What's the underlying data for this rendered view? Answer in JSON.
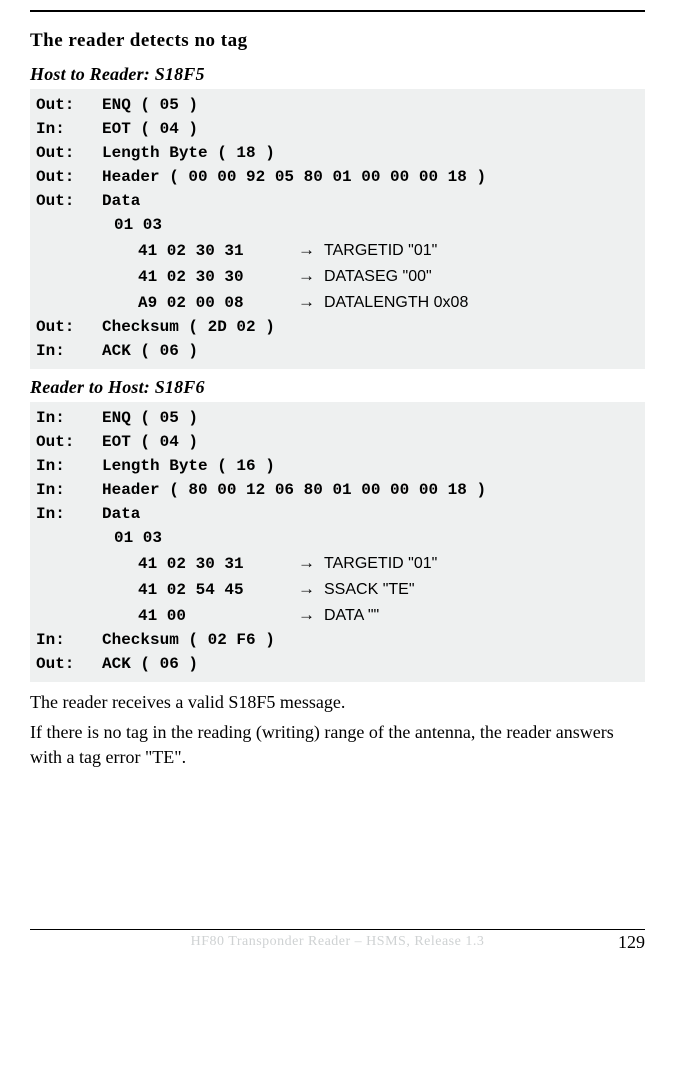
{
  "title": "The reader detects no tag",
  "section1": {
    "heading": "Host to Reader: S18F5",
    "rows": [
      {
        "dir": "Out:",
        "text": "ENQ ( 05 )"
      },
      {
        "dir": "In:",
        "text": "EOT ( 04 )"
      },
      {
        "dir": "Out:",
        "text": "Length Byte ( 18 )"
      },
      {
        "dir": "Out:",
        "text": "Header ( 00 00 92 05 80 01 00 00 00 18 )"
      },
      {
        "dir": "Out:",
        "text": "Data"
      }
    ],
    "data_first": "01 03",
    "data_sub": [
      {
        "hex": "41 02 30 31",
        "arrow": "→",
        "desc": "TARGETID \"01\""
      },
      {
        "hex": "41 02 30 30",
        "arrow": "→",
        "desc": "DATASEG \"00\""
      },
      {
        "hex": "A9 02 00 08",
        "arrow": "→",
        "desc": "DATALENGTH 0x08"
      }
    ],
    "rows_after": [
      {
        "dir": "Out:",
        "text": "Checksum ( 2D 02 )"
      },
      {
        "dir": "In:",
        "text": "ACK ( 06 )"
      }
    ]
  },
  "section2": {
    "heading": "Reader to Host: S18F6",
    "rows": [
      {
        "dir": "In:",
        "text": "ENQ ( 05 )"
      },
      {
        "dir": "Out:",
        "text": "EOT ( 04 )"
      },
      {
        "dir": "In:",
        "text": "Length Byte ( 16 )"
      },
      {
        "dir": "In:",
        "text": "Header ( 80 00 12 06 80 01 00 00 00 18 )"
      },
      {
        "dir": "In:",
        "text": "Data"
      }
    ],
    "data_first": "01 03",
    "data_sub": [
      {
        "hex": "41 02 30 31",
        "arrow": "→",
        "desc": "TARGETID \"01\""
      },
      {
        "hex": "41 02 54 45",
        "arrow": "→",
        "desc": "SSACK \"TE\""
      },
      {
        "hex": "41 00",
        "arrow": "→",
        "desc": "DATA \"\""
      }
    ],
    "rows_after": [
      {
        "dir": "In:",
        "text": "Checksum ( 02 F6 )"
      },
      {
        "dir": "Out:",
        "text": "ACK ( 06 )"
      }
    ]
  },
  "paragraphs": [
    "The reader receives a valid S18F5 message.",
    "If there is no tag in the reading (writing) range of the antenna, the reader answers with a tag error \"TE\"."
  ],
  "footer_center": "HF80 Transponder Reader – HSMS, Release 1.3",
  "page_number": "129"
}
